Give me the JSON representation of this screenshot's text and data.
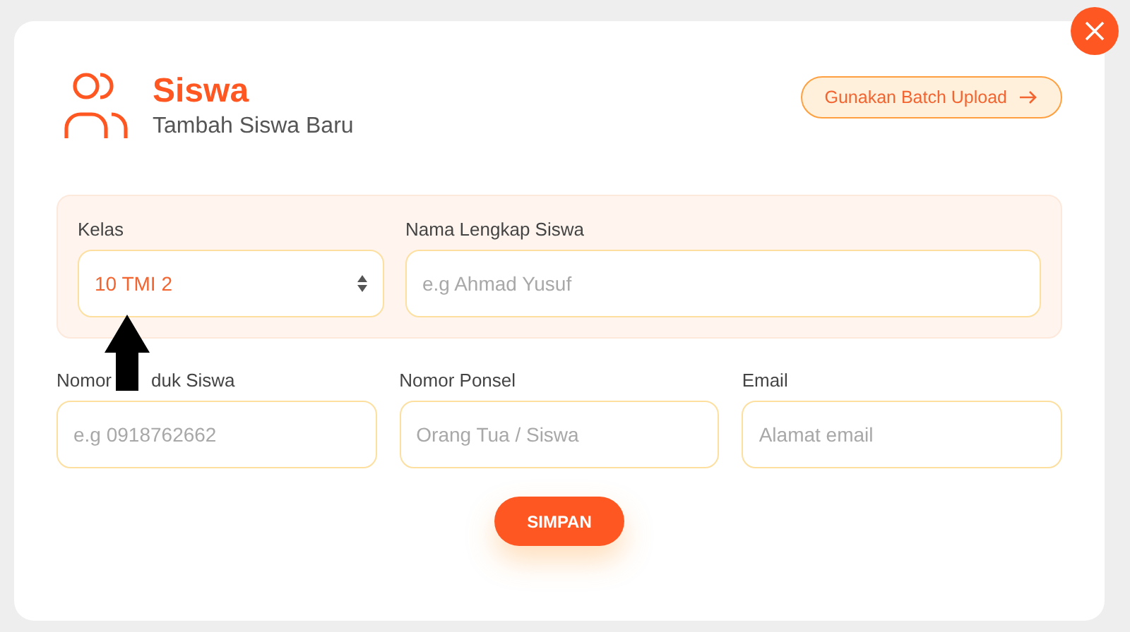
{
  "header": {
    "title": "Siswa",
    "subtitle": "Tambah Siswa Baru"
  },
  "batch_button": {
    "label": "Gunakan Batch Upload"
  },
  "kelas": {
    "label": "Kelas",
    "value": "10 TMI 2"
  },
  "nama": {
    "label": "Nama Lengkap Siswa",
    "placeholder": "e.g Ahmad Yusuf"
  },
  "fields": [
    {
      "label_parts": [
        "Nomor",
        "duk Siswa"
      ],
      "placeholder": "e.g 0918762662"
    },
    {
      "label_parts": [
        "Nomor Ponsel"
      ],
      "placeholder": "Orang Tua / Siswa"
    },
    {
      "label_parts": [
        "Email"
      ],
      "placeholder": "Alamat email"
    }
  ],
  "save_button": {
    "label": "SIMPAN"
  }
}
